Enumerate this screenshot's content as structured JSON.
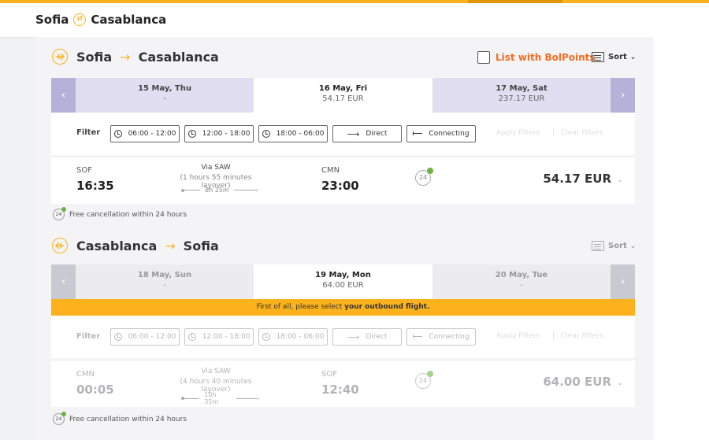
{
  "header": {
    "from": "Sofia",
    "to": "Casablanca"
  },
  "outbound": {
    "from": "Sofia",
    "to": "Casablanca",
    "bolpoints_label": "List with BolPoints",
    "sort_label": "Sort",
    "dates": [
      {
        "date": "15 May, Thu",
        "price": "-"
      },
      {
        "date": "16 May, Fri",
        "price": "54.17 EUR"
      },
      {
        "date": "17 May, Sat",
        "price": "237.17 EUR"
      }
    ],
    "filter": {
      "label": "Filter",
      "morning": "06:00 - 12:00",
      "afternoon": "12:00 - 18:00",
      "night": "18:00 - 06:00",
      "direct": "Direct",
      "connecting": "Connecting",
      "apply": "Apply Filters",
      "clear": "Clear Filters"
    },
    "flight": {
      "dep_code": "SOF",
      "dep_time": "16:35",
      "via": "Via SAW",
      "layover": "(1 hours 55 minutes layover)",
      "duration": "8h 25m",
      "arr_code": "CMN",
      "arr_time": "23:00",
      "badge": "24",
      "price": "54.17 EUR"
    },
    "free_cancel": "Free cancellation within 24 hours"
  },
  "return": {
    "from": "Casablanca",
    "to": "Sofia",
    "sort_label": "Sort",
    "dates": [
      {
        "date": "18 May, Sun",
        "price": "-"
      },
      {
        "date": "19 May, Mon",
        "price": "64.00 EUR"
      },
      {
        "date": "20 May, Tue",
        "price": "-"
      }
    ],
    "notice_pre": "First of all, please select ",
    "notice_bold": "your outbound flight.",
    "filter": {
      "label": "Filter",
      "morning": "06:00 - 12:00",
      "afternoon": "12:00 - 18:00",
      "night": "18:00 - 06:00",
      "direct": "Direct",
      "connecting": "Connecting",
      "apply": "Apply Filters",
      "clear": "Clear Filters"
    },
    "flight": {
      "dep_code": "CMN",
      "dep_time": "00:05",
      "via": "Via SAW",
      "layover": "(4 hours 40 minutes layover)",
      "duration": "10h 35m",
      "arr_code": "SOF",
      "arr_time": "12:40",
      "badge": "24",
      "price": "64.00 EUR"
    },
    "free_cancel": "Free cancellation within 24 hours"
  },
  "colors": {
    "accent": "#fbb21c",
    "link": "#f26d24",
    "date_nav": "#b5b1d9",
    "date_cell": "#e0def0"
  },
  "icons": {
    "plane": "plane-icon",
    "swap": "swap-icon",
    "sort": "sort-icon",
    "clock": "clock-icon"
  }
}
